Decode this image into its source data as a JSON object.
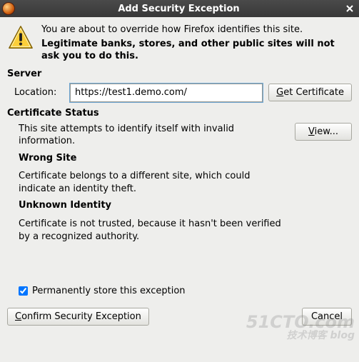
{
  "titlebar": {
    "title": "Add Security Exception"
  },
  "warning": {
    "line1": "You are about to override how Firefox identifies this site.",
    "line2": "Legitimate banks, stores, and other public sites will not ask you to do this."
  },
  "server": {
    "heading": "Server",
    "location_label": "Location:",
    "location_value": "https://test1.demo.com/",
    "get_cert_prefix": "G",
    "get_cert_rest": "et Certificate"
  },
  "cert": {
    "heading": "Certificate Status",
    "intro": "This site attempts to identify itself with invalid information.",
    "view_prefix": "V",
    "view_rest": "iew...",
    "wrong_site_h": "Wrong Site",
    "wrong_site_p": "Certificate belongs to a different site, which could indicate an identity theft.",
    "unknown_h": "Unknown Identity",
    "unknown_p": "Certificate is not trusted, because it hasn't been verified by a recognized authority."
  },
  "perm": {
    "prefix": "P",
    "rest": "ermanently store this exception"
  },
  "buttons": {
    "confirm_prefix": "C",
    "confirm_rest": "onfirm Security Exception",
    "cancel": "Cancel"
  },
  "watermark": {
    "main": "51CTO.com",
    "sub": "技术博客 blog"
  }
}
